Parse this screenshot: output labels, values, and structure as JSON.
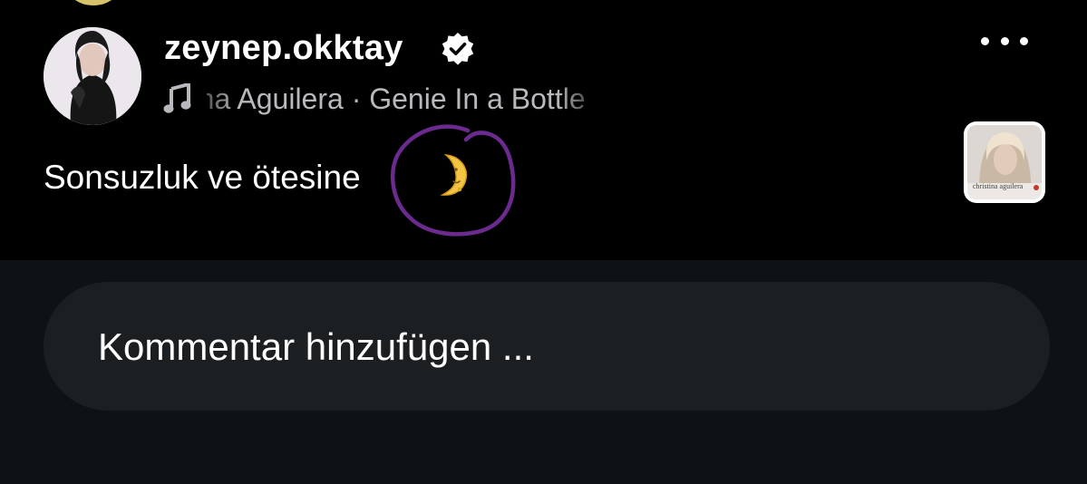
{
  "post": {
    "username": "zeynep.okktay",
    "verified": true,
    "song": "Christina Aguilera · Genie In a Bottle",
    "caption": "Sonsuzluk ve ötesine",
    "album_art_text": "christina aguilera"
  },
  "comment_box": {
    "placeholder": "Kommentar hinzufügen ..."
  },
  "icons": {
    "more": "more-options-icon",
    "music": "music-note-icon",
    "verified": "verified-badge-icon",
    "emoji": "moon-emoji-icon"
  },
  "colors": {
    "background": "#000000",
    "comment_area": "#0f1215",
    "input_bg": "#1c1f22",
    "annotation": "#6a2a8e",
    "muted_text": "#b9b9bd"
  }
}
